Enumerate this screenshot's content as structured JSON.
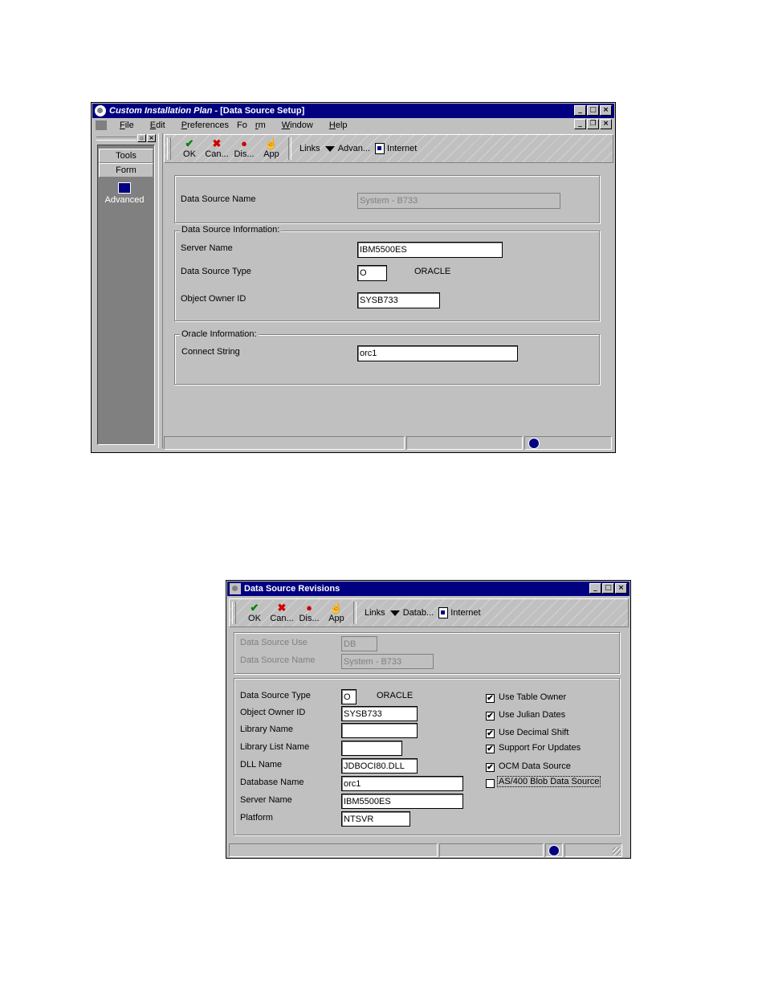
{
  "window1": {
    "title_app": "Custom Installation Plan",
    "title_doc": " - [Data Source Setup]",
    "menu": [
      "File",
      "Edit",
      "Preferences",
      "Form",
      "Window",
      "Help"
    ],
    "sidebar": {
      "tools_label": "Tools",
      "form_label": "Form",
      "advanced_label": "Advanced"
    },
    "toolbar": {
      "ok": "OK",
      "cancel": "Can...",
      "display": "Dis...",
      "app": "App",
      "links": "Links",
      "advanced": "Advan...",
      "internet": "Internet"
    },
    "form": {
      "data_source_name_label": "Data Source Name",
      "data_source_name_value": "System - B733",
      "info_group_title": "Data Source Information:",
      "server_name_label": "Server Name",
      "server_name_value": "IBM5500ES",
      "data_source_type_label": "Data Source Type",
      "data_source_type_value": "O",
      "data_source_type_desc": "ORACLE",
      "object_owner_label": "Object Owner ID",
      "object_owner_value": "SYSB733",
      "oracle_group_title": "Oracle Information:",
      "connect_string_label": "Connect String",
      "connect_string_value": "orc1"
    }
  },
  "window2": {
    "title": "Data Source Revisions",
    "toolbar": {
      "ok": "OK",
      "cancel": "Can...",
      "display": "Dis...",
      "app": "App",
      "links": "Links",
      "database": "Datab...",
      "internet": "Internet"
    },
    "header": {
      "data_source_use_label": "Data Source Use",
      "data_source_use_value": "DB",
      "data_source_name_label": "Data Source Name",
      "data_source_name_value": "System - B733"
    },
    "form": {
      "type_label": "Data Source Type",
      "type_value": "O",
      "type_desc": "ORACLE",
      "owner_label": "Object Owner ID",
      "owner_value": "SYSB733",
      "library_label": "Library Name",
      "library_value": "",
      "library_list_label": "Library List Name",
      "library_list_value": "",
      "dll_label": "DLL Name",
      "dll_value": "JDBOCI80.DLL",
      "database_label": "Database Name",
      "database_value": "orc1",
      "server_label": "Server Name",
      "server_value": "IBM5500ES",
      "platform_label": "Platform",
      "platform_value": "NTSVR"
    },
    "options": [
      {
        "label": "Use Table Owner",
        "checked": true
      },
      {
        "label": "Use Julian Dates",
        "checked": true
      },
      {
        "label": "Use Decimal Shift",
        "checked": true
      },
      {
        "label": "Support For Updates",
        "checked": true
      },
      {
        "label": "OCM Data Source",
        "checked": true
      },
      {
        "label": "AS/400 Blob Data Source",
        "checked": false
      }
    ]
  }
}
